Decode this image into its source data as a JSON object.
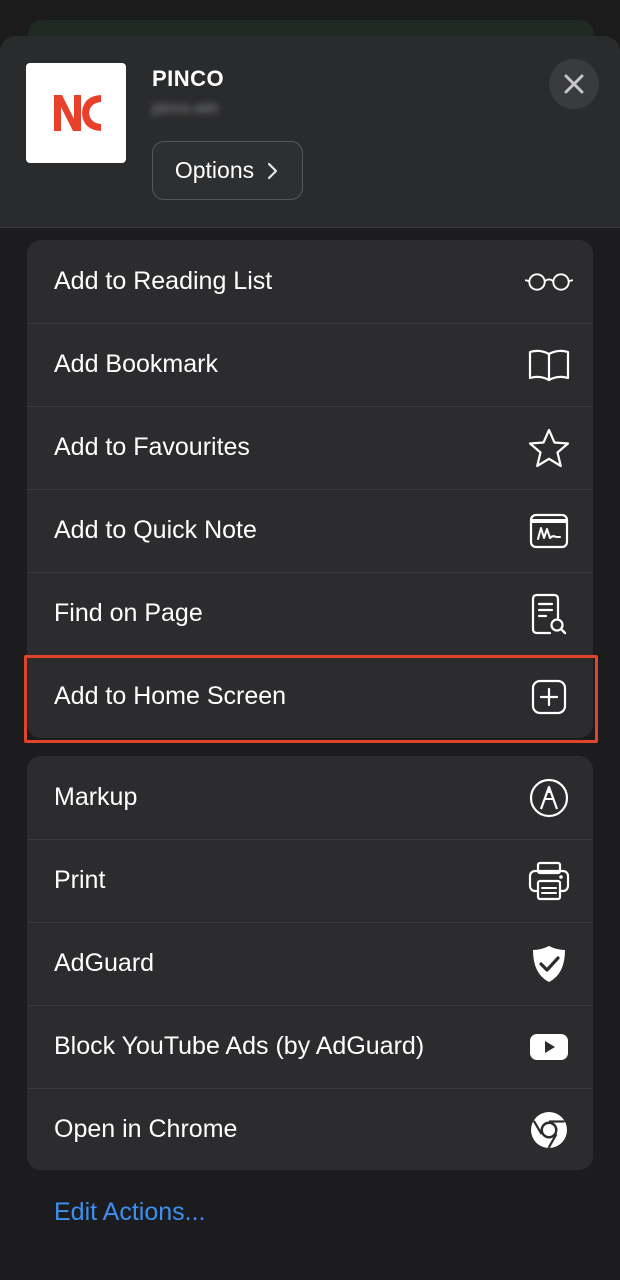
{
  "header": {
    "site_title": "PINCO",
    "site_url": "pinco.win",
    "app_icon_text": "NC",
    "options_label": "Options"
  },
  "group1": [
    {
      "label": "Add to Reading List",
      "icon": "glasses-icon"
    },
    {
      "label": "Add Bookmark",
      "icon": "book-icon"
    },
    {
      "label": "Add to Favourites",
      "icon": "star-icon"
    },
    {
      "label": "Add to Quick Note",
      "icon": "quick-note-icon"
    },
    {
      "label": "Find on Page",
      "icon": "find-on-page-icon"
    },
    {
      "label": "Add to Home Screen",
      "icon": "plus-square-icon"
    }
  ],
  "group2": [
    {
      "label": "Markup",
      "icon": "markup-pen-icon"
    },
    {
      "label": "Print",
      "icon": "printer-icon"
    },
    {
      "label": "AdGuard",
      "icon": "shield-check-icon"
    },
    {
      "label": "Block YouTube Ads (by AdGuard)",
      "icon": "youtube-play-icon"
    },
    {
      "label": "Open in Chrome",
      "icon": "chrome-icon"
    }
  ],
  "edit_actions_label": "Edit Actions...",
  "colors": {
    "accent_link": "#3d8ff1",
    "highlight_border": "#e0452c",
    "brand_red": "#e8402b"
  }
}
